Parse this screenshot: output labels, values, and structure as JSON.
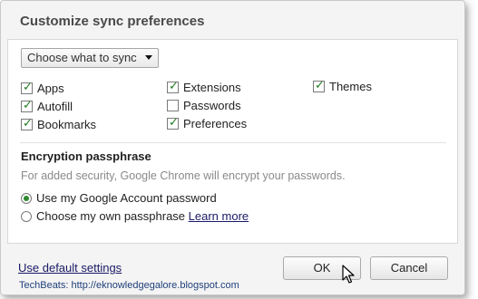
{
  "dialog": {
    "title": "Customize sync preferences"
  },
  "sync_select": {
    "value": "Choose what to sync"
  },
  "sync_options": [
    {
      "label": "Apps",
      "checked": true
    },
    {
      "label": "Autofill",
      "checked": true
    },
    {
      "label": "Bookmarks",
      "checked": true
    },
    {
      "label": "Extensions",
      "checked": true
    },
    {
      "label": "Passwords",
      "checked": false
    },
    {
      "label": "Preferences",
      "checked": true
    },
    {
      "label": "Themes",
      "checked": true
    }
  ],
  "encryption": {
    "title": "Encryption passphrase",
    "description": "For added security, Google Chrome will encrypt your passwords.",
    "options": [
      {
        "label": "Use my Google Account password",
        "selected": true
      },
      {
        "label": "Choose my own passphrase",
        "selected": false
      }
    ],
    "learn_more": "Learn more"
  },
  "footer": {
    "default_link": "Use default settings",
    "ok_label": "OK",
    "cancel_label": "Cancel"
  },
  "watermark": "TechBeats: http://eknowledgegalore.blogspot.com"
}
